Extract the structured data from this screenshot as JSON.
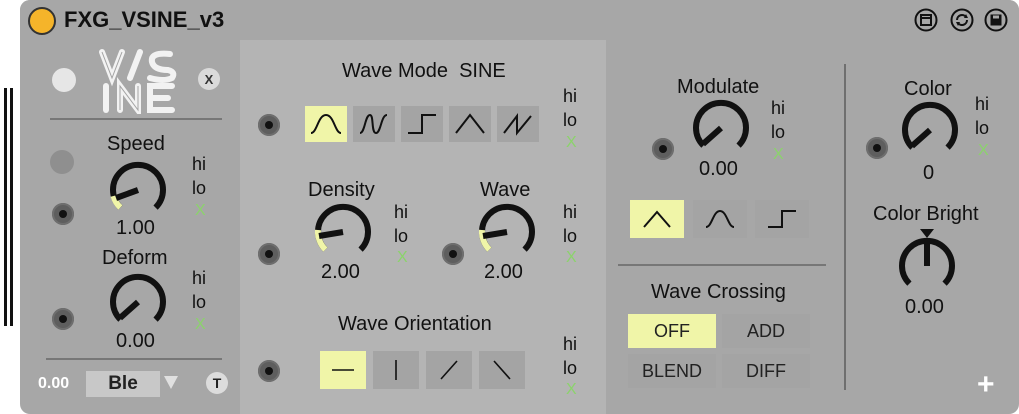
{
  "window": {
    "title": "FXG_VSINE_v3",
    "header_icons": [
      "freeze-icon",
      "hot-swap-icon",
      "save-preset-icon"
    ]
  },
  "left": {
    "logo_text": "V/SINE",
    "close_label": "X",
    "speed": {
      "label": "Speed",
      "value": "1.00",
      "hi": "hi",
      "lo": "lo",
      "x": "X"
    },
    "deform": {
      "label": "Deform",
      "value": "0.00",
      "hi": "hi",
      "lo": "lo",
      "x": "X"
    },
    "blend": {
      "value": "0.00",
      "mode": "Ble",
      "t_label": "T"
    }
  },
  "wave": {
    "title": "Wave Mode",
    "mode": "SINE",
    "hi": "hi",
    "lo": "lo",
    "x": "X",
    "mode_buttons": [
      "sine-wave",
      "s-curve-wave",
      "square-wave",
      "triangle-wave",
      "saw-wave"
    ],
    "selected_mode": 0,
    "density": {
      "label": "Density",
      "value": "2.00",
      "hi": "hi",
      "lo": "lo",
      "x": "X"
    },
    "wave": {
      "label": "Wave",
      "value": "2.00",
      "hi": "hi",
      "lo": "lo",
      "x": "X"
    },
    "orientation": {
      "title": "Wave Orientation",
      "hi": "hi",
      "lo": "lo",
      "x": "X",
      "buttons": [
        "horizontal",
        "vertical",
        "diagonal-up",
        "diagonal-down"
      ],
      "selected": 0
    }
  },
  "modulate": {
    "label": "Modulate",
    "value": "0.00",
    "hi": "hi",
    "lo": "lo",
    "x": "X",
    "shape_buttons": [
      "triangle",
      "sine",
      "square"
    ],
    "selected_shape": 0
  },
  "crossing": {
    "title": "Wave Crossing",
    "buttons": [
      "OFF",
      "ADD",
      "BLEND",
      "DIFF"
    ],
    "selected": 0
  },
  "color": {
    "label": "Color",
    "value": "0",
    "hi": "hi",
    "lo": "lo",
    "x": "X",
    "bright_label": "Color Bright",
    "bright_value": "0.00",
    "plus_label": "+"
  },
  "colors": {
    "frame": "#a7a7a7",
    "panel": "#b4b4b4",
    "active": "#f0f5a8",
    "xgreen": "#8bd36b"
  }
}
